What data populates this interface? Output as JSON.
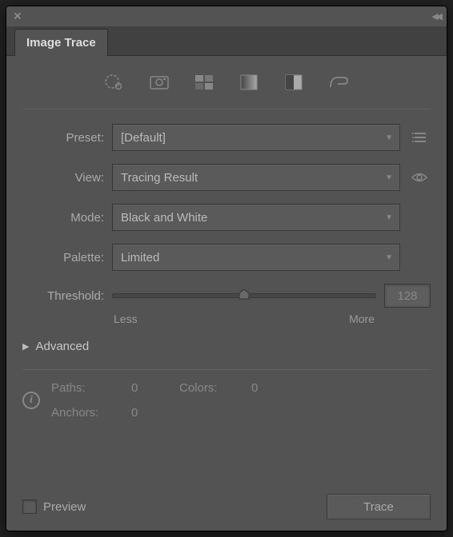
{
  "panel": {
    "title": "Image Trace"
  },
  "dropdowns": {
    "preset": {
      "label": "Preset:",
      "value": "[Default]"
    },
    "view": {
      "label": "View:",
      "value": "Tracing Result"
    },
    "mode": {
      "label": "Mode:",
      "value": "Black and White"
    },
    "palette": {
      "label": "Palette:",
      "value": "Limited"
    }
  },
  "threshold": {
    "label": "Threshold:",
    "value": "128",
    "less": "Less",
    "more": "More"
  },
  "advanced": {
    "label": "Advanced"
  },
  "info": {
    "paths_label": "Paths:",
    "paths_value": "0",
    "colors_label": "Colors:",
    "colors_value": "0",
    "anchors_label": "Anchors:",
    "anchors_value": "0"
  },
  "footer": {
    "preview_label": "Preview",
    "trace_label": "Trace"
  }
}
